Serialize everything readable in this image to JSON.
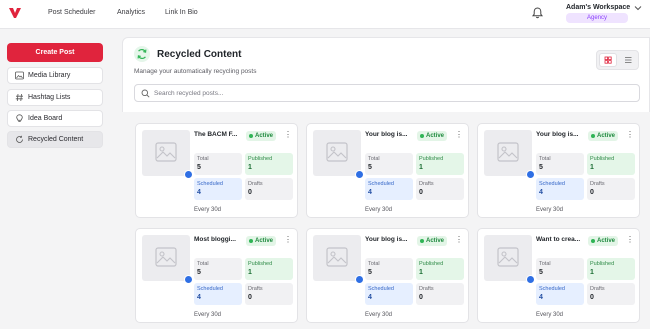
{
  "topbar": {
    "nav": [
      "Post Scheduler",
      "Analytics",
      "Link In Bio"
    ],
    "workspace_name": "Adam's Workspace",
    "workspace_badge": "Agency"
  },
  "sidebar": {
    "create_label": "Create Post",
    "items": [
      {
        "label": "Media Library",
        "icon": "image-icon"
      },
      {
        "label": "Hashtag Lists",
        "icon": "hash-icon"
      },
      {
        "label": "Idea Board",
        "icon": "lightbulb-icon"
      },
      {
        "label": "Recycled Content",
        "icon": "recycle-icon",
        "active": true
      }
    ]
  },
  "main": {
    "title": "Recycled Content",
    "subtitle": "Manage your automatically recycling posts",
    "search_placeholder": "Search recycled posts..."
  },
  "labels": {
    "total": "Total",
    "published": "Published",
    "scheduled": "Scheduled",
    "drafts": "Drafts"
  },
  "cards": [
    {
      "title": "The BACM F...",
      "status": "Active",
      "total": "5",
      "published": "1",
      "scheduled": "4",
      "drafts": "0",
      "frequency": "Every 30d"
    },
    {
      "title": "Your blog is...",
      "status": "Active",
      "total": "5",
      "published": "1",
      "scheduled": "4",
      "drafts": "0",
      "frequency": "Every 30d"
    },
    {
      "title": "Your blog is...",
      "status": "Active",
      "total": "5",
      "published": "1",
      "scheduled": "4",
      "drafts": "0",
      "frequency": "Every 30d"
    },
    {
      "title": "Most bloggi...",
      "status": "Active",
      "total": "5",
      "published": "1",
      "scheduled": "4",
      "drafts": "0",
      "frequency": "Every 30d"
    },
    {
      "title": "Your blog is...",
      "status": "Active",
      "total": "5",
      "published": "1",
      "scheduled": "4",
      "drafts": "0",
      "frequency": "Every 30d"
    },
    {
      "title": "Want to crea...",
      "status": "Active",
      "total": "5",
      "published": "1",
      "scheduled": "4",
      "drafts": "0",
      "frequency": "Every 30d"
    }
  ],
  "colors": {
    "brand": "#e0243d",
    "active_green": "#2fb455",
    "scheduled_blue": "#2f6fe4",
    "agency_purple": "#8a3ffc"
  }
}
